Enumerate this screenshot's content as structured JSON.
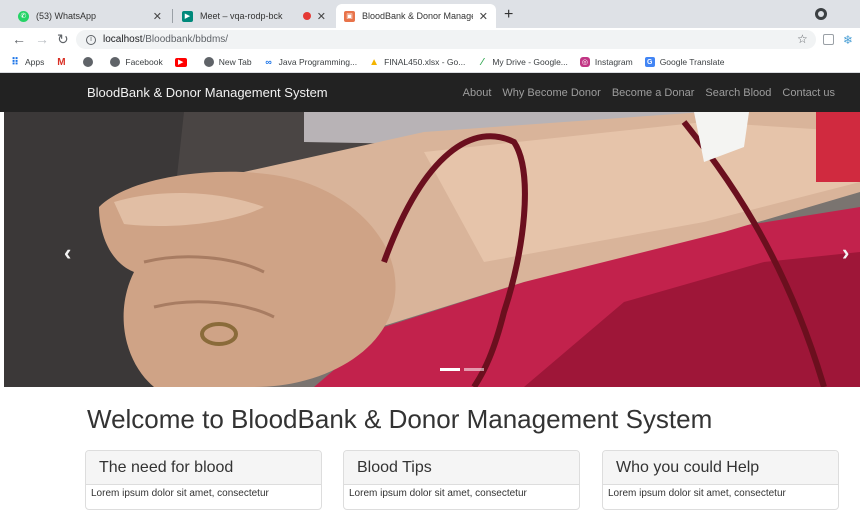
{
  "browser": {
    "tabs": [
      {
        "title": "(53) WhatsApp",
        "icon": "whatsapp-icon"
      },
      {
        "title": "Meet – vqa-rodp-bck",
        "icon": "google-meet-icon"
      },
      {
        "title": "BloodBank & Donor Manageme",
        "icon": "site-favicon"
      }
    ],
    "url_host": "localhost",
    "url_path": "/Bloodbank/bbdms/",
    "bookmarks": [
      {
        "label": "Apps",
        "icon": "apps-grid-icon"
      },
      {
        "label": "",
        "icon": "gmail-icon"
      },
      {
        "label": "",
        "icon": "globe-icon"
      },
      {
        "label": "Facebook",
        "icon": "globe-icon"
      },
      {
        "label": "",
        "icon": "youtube-icon"
      },
      {
        "label": "New Tab",
        "icon": "globe-icon"
      },
      {
        "label": "Java Programming...",
        "icon": "link-icon"
      },
      {
        "label": "FINAL450.xlsx - Go...",
        "icon": "google-drive-icon"
      },
      {
        "label": "My Drive - Google...",
        "icon": "google-drive-icon"
      },
      {
        "label": "Instagram",
        "icon": "instagram-icon"
      },
      {
        "label": "Google Translate",
        "icon": "google-translate-icon"
      }
    ]
  },
  "site": {
    "brand": "BloodBank & Donor Management System",
    "nav": [
      "About",
      "Why Become Donor",
      "Become a Donar",
      "Search Blood",
      "Contact us"
    ],
    "welcome": "Welcome to BloodBank & Donor Management System",
    "panels": [
      {
        "title": "The need for blood",
        "body": "Lorem ipsum dolor sit amet, consectetur"
      },
      {
        "title": "Blood Tips",
        "body": "Lorem ipsum dolor sit amet, consectetur"
      },
      {
        "title": "Who you could Help",
        "body": "Lorem ipsum dolor sit amet, consectetur"
      }
    ]
  },
  "colors": {
    "navbar_bg": "#222222",
    "nav_link": "#9d9d9d",
    "panel_head_bg": "#f5f5f5"
  }
}
